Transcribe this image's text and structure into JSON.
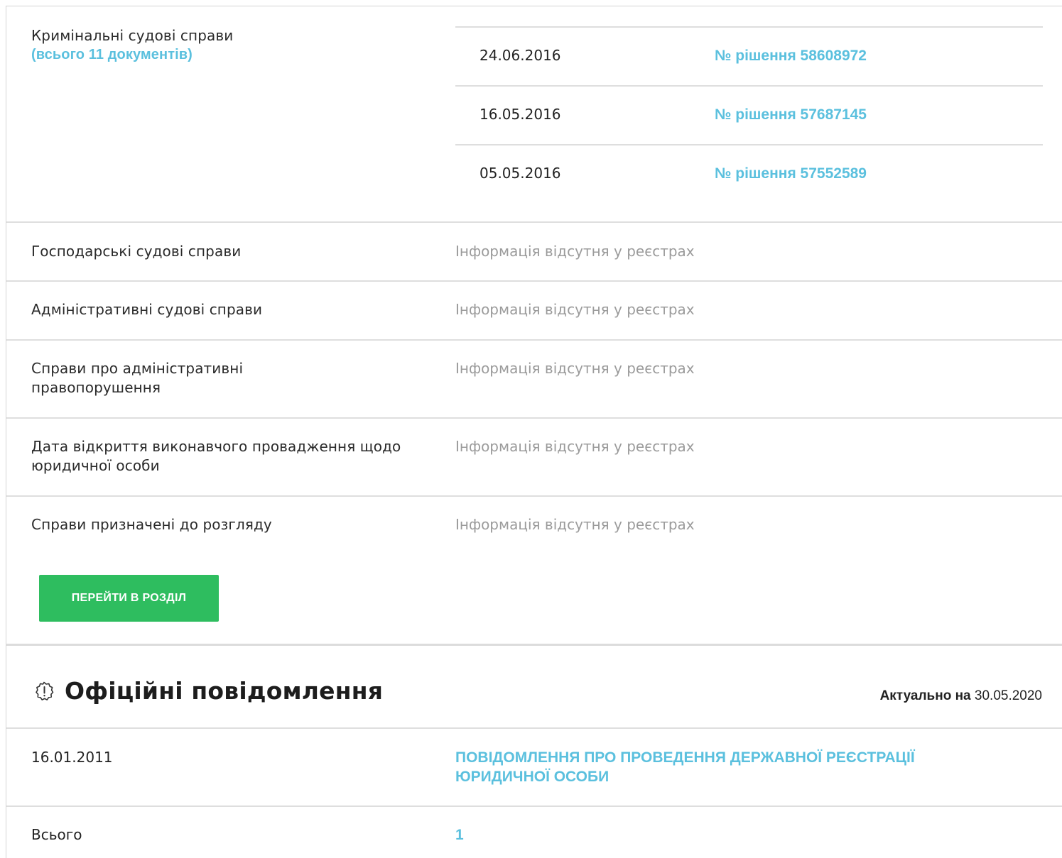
{
  "courts": {
    "criminal": {
      "label": "Кримінальні судові справи",
      "count_text": "(всього 11 документів)",
      "decisions": [
        {
          "date": "24.06.2016",
          "number": "№ рішення 58608972"
        },
        {
          "date": "16.05.2016",
          "number": "№ рішення 57687145"
        },
        {
          "date": "05.05.2016",
          "number": "№ рішення 57552589"
        }
      ]
    },
    "rows": [
      {
        "label": "Господарські судові справи",
        "value": "Інформація відсутня у реєстрах"
      },
      {
        "label": "Адміністративні судові справи",
        "value": "Інформація відсутня у реєстрах"
      },
      {
        "label": "Справи про адміністративні правопорушення",
        "value": "Інформація відсутня у реєстрах"
      },
      {
        "label": "Дата відкриття виконавчого провадження щодо юридичної особи",
        "value": "Інформація відсутня у реєстрах"
      },
      {
        "label": "Справи призначені до розгляду",
        "value": "Інформація відсутня у реєстрах"
      }
    ],
    "button_label": "ПЕРЕЙТИ В РОЗДІЛ"
  },
  "notices": {
    "title": "Офіційні повідомлення",
    "actual_label": "Актуально на",
    "actual_date": "30.05.2020",
    "items": [
      {
        "date": "16.01.2011",
        "title": "ПОВІДОМЛЕННЯ ПРО ПРОВЕДЕННЯ ДЕРЖАВНОЇ РЕЄСТРАЦІЇ ЮРИДИЧНОЇ ОСОБИ"
      }
    ],
    "total_label": "Всього",
    "total_value": "1"
  },
  "colors": {
    "link": "#5bc0de",
    "button": "#2ebd5f",
    "muted": "#9b9b9b"
  },
  "icons": {
    "notices": "alert-badge-icon"
  }
}
